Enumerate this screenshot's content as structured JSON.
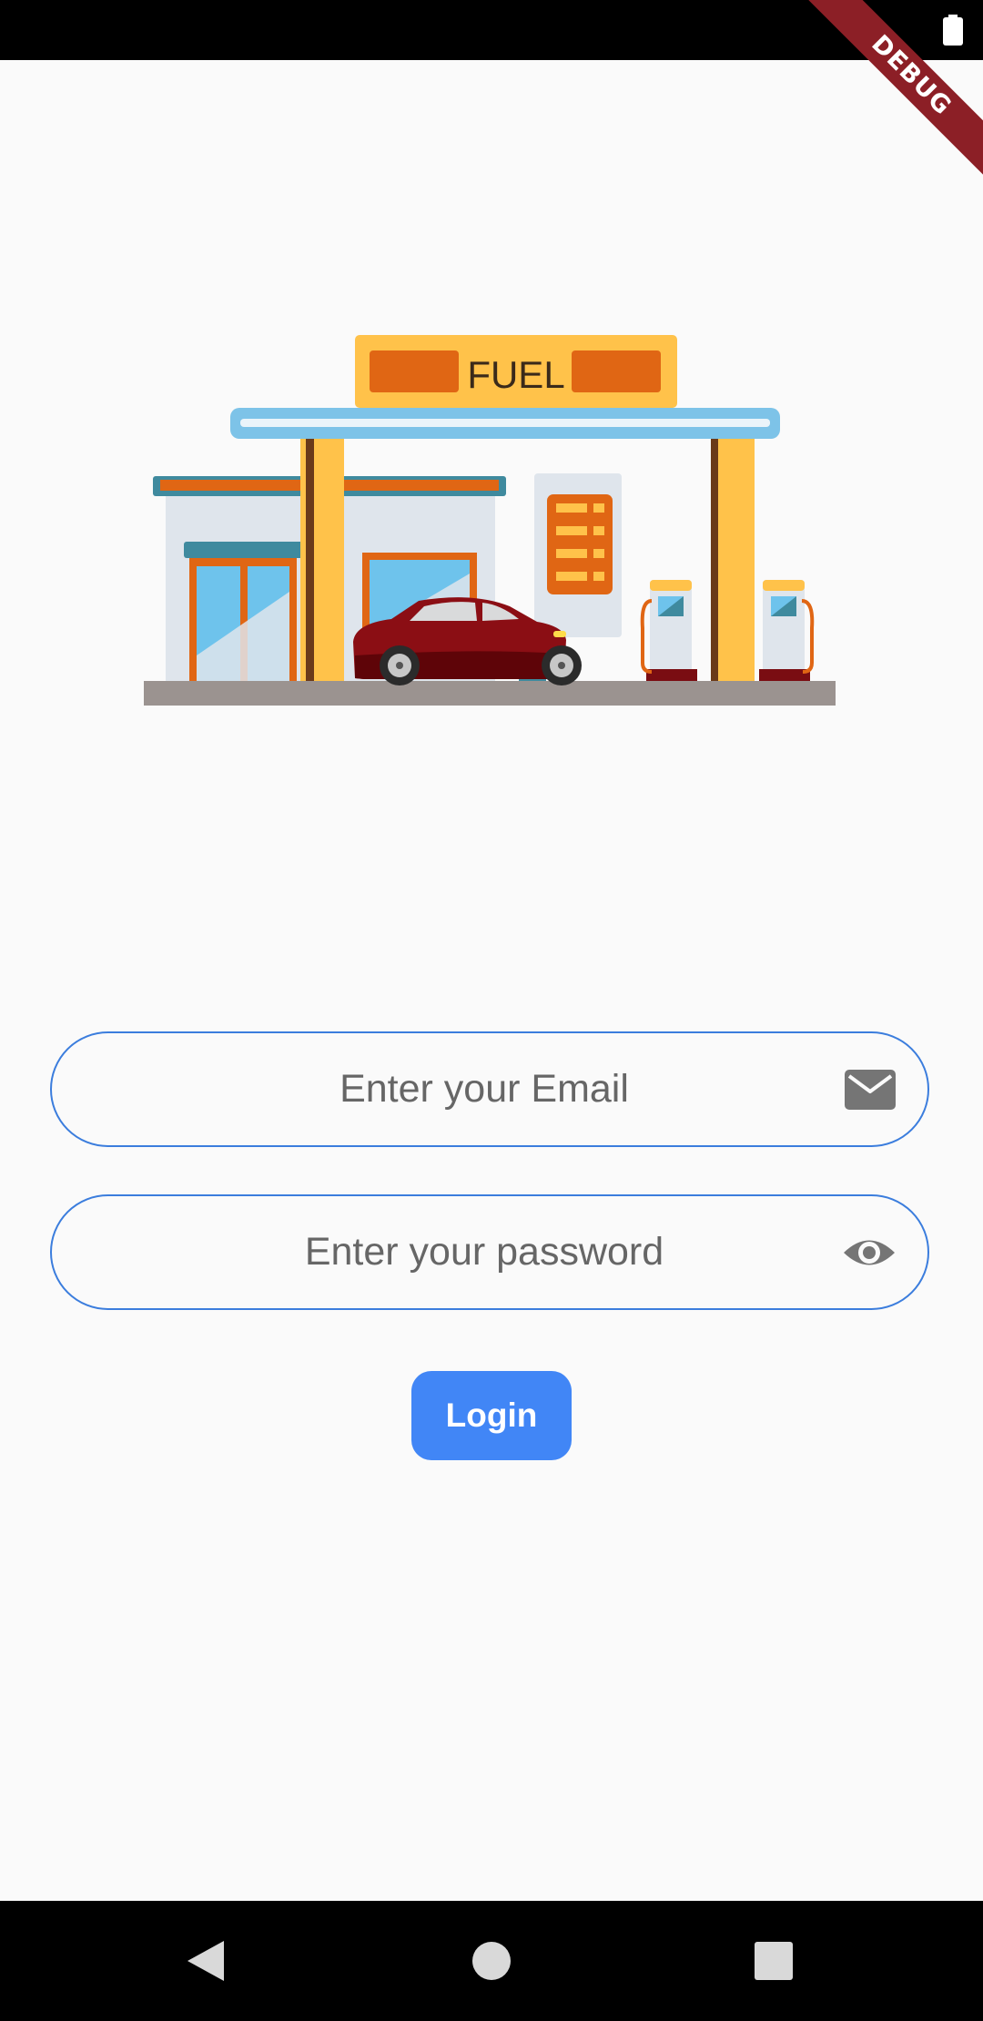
{
  "status_bar": {
    "battery_icon": "battery-full-icon"
  },
  "debug_banner": {
    "label": "DEBUG"
  },
  "illustration": {
    "sign_text": "FUEL"
  },
  "form": {
    "email": {
      "placeholder": "Enter your Email",
      "icon": "mail-icon"
    },
    "password": {
      "placeholder": "Enter your password",
      "icon": "eye-icon"
    },
    "login_label": "Login"
  },
  "nav_bar": {
    "back_icon": "back-triangle-icon",
    "home_icon": "home-circle-icon",
    "recents_icon": "recents-square-icon"
  },
  "colors": {
    "accent": "#4186f6",
    "field_border": "#3b7ddd",
    "background": "#fafafa",
    "debug": "#8c1f26"
  }
}
